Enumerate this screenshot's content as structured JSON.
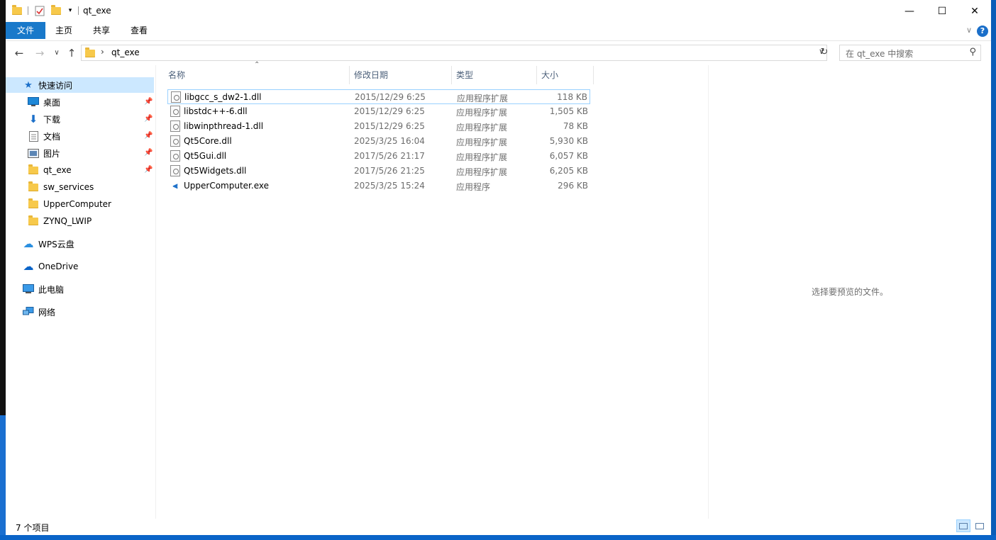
{
  "window": {
    "title": "qt_exe",
    "controls": {
      "minimize": "—",
      "maximize": "☐",
      "close": "✕"
    }
  },
  "ribbon": {
    "tabs": [
      "文件",
      "主页",
      "共享",
      "查看"
    ],
    "help": "?"
  },
  "address": {
    "path": "qt_exe",
    "search_placeholder": "在 qt_exe 中搜索"
  },
  "nav_pane": {
    "quick_access": "快速访问",
    "pinned": [
      {
        "label": "桌面",
        "icon": "desktop-icon"
      },
      {
        "label": "下载",
        "icon": "download-icon"
      },
      {
        "label": "文档",
        "icon": "document-icon"
      },
      {
        "label": "图片",
        "icon": "picture-icon"
      },
      {
        "label": "qt_exe",
        "icon": "folder-icon"
      }
    ],
    "folders": [
      "sw_services",
      "UpperComputer",
      "ZYNQ_LWIP"
    ],
    "roots": [
      {
        "label": "WPS云盘",
        "icon": "wps-cloud-icon"
      },
      {
        "label": "OneDrive",
        "icon": "onedrive-icon"
      },
      {
        "label": "此电脑",
        "icon": "computer-icon"
      },
      {
        "label": "网络",
        "icon": "network-icon"
      }
    ]
  },
  "file_list": {
    "columns": {
      "name": "名称",
      "date": "修改日期",
      "type": "类型",
      "size": "大小"
    },
    "rows": [
      {
        "name": "libgcc_s_dw2-1.dll",
        "date": "2015/12/29 6:25",
        "type": "应用程序扩展",
        "size": "118 KB",
        "icon": "dll-icon"
      },
      {
        "name": "libstdc++-6.dll",
        "date": "2015/12/29 6:25",
        "type": "应用程序扩展",
        "size": "1,505 KB",
        "icon": "dll-icon"
      },
      {
        "name": "libwinpthread-1.dll",
        "date": "2015/12/29 6:25",
        "type": "应用程序扩展",
        "size": "78 KB",
        "icon": "dll-icon"
      },
      {
        "name": "Qt5Core.dll",
        "date": "2025/3/25 16:04",
        "type": "应用程序扩展",
        "size": "5,930 KB",
        "icon": "dll-icon"
      },
      {
        "name": "Qt5Gui.dll",
        "date": "2017/5/26 21:17",
        "type": "应用程序扩展",
        "size": "6,057 KB",
        "icon": "dll-icon"
      },
      {
        "name": "Qt5Widgets.dll",
        "date": "2017/5/26 21:25",
        "type": "应用程序扩展",
        "size": "6,205 KB",
        "icon": "dll-icon"
      },
      {
        "name": "UpperComputer.exe",
        "date": "2025/3/25 15:24",
        "type": "应用程序",
        "size": "296 KB",
        "icon": "exe-icon"
      }
    ]
  },
  "preview": {
    "message": "选择要预览的文件。"
  },
  "status": {
    "count": "7 个项目"
  },
  "colors": {
    "accent": "#1979ca",
    "selection": "#cce8ff"
  }
}
